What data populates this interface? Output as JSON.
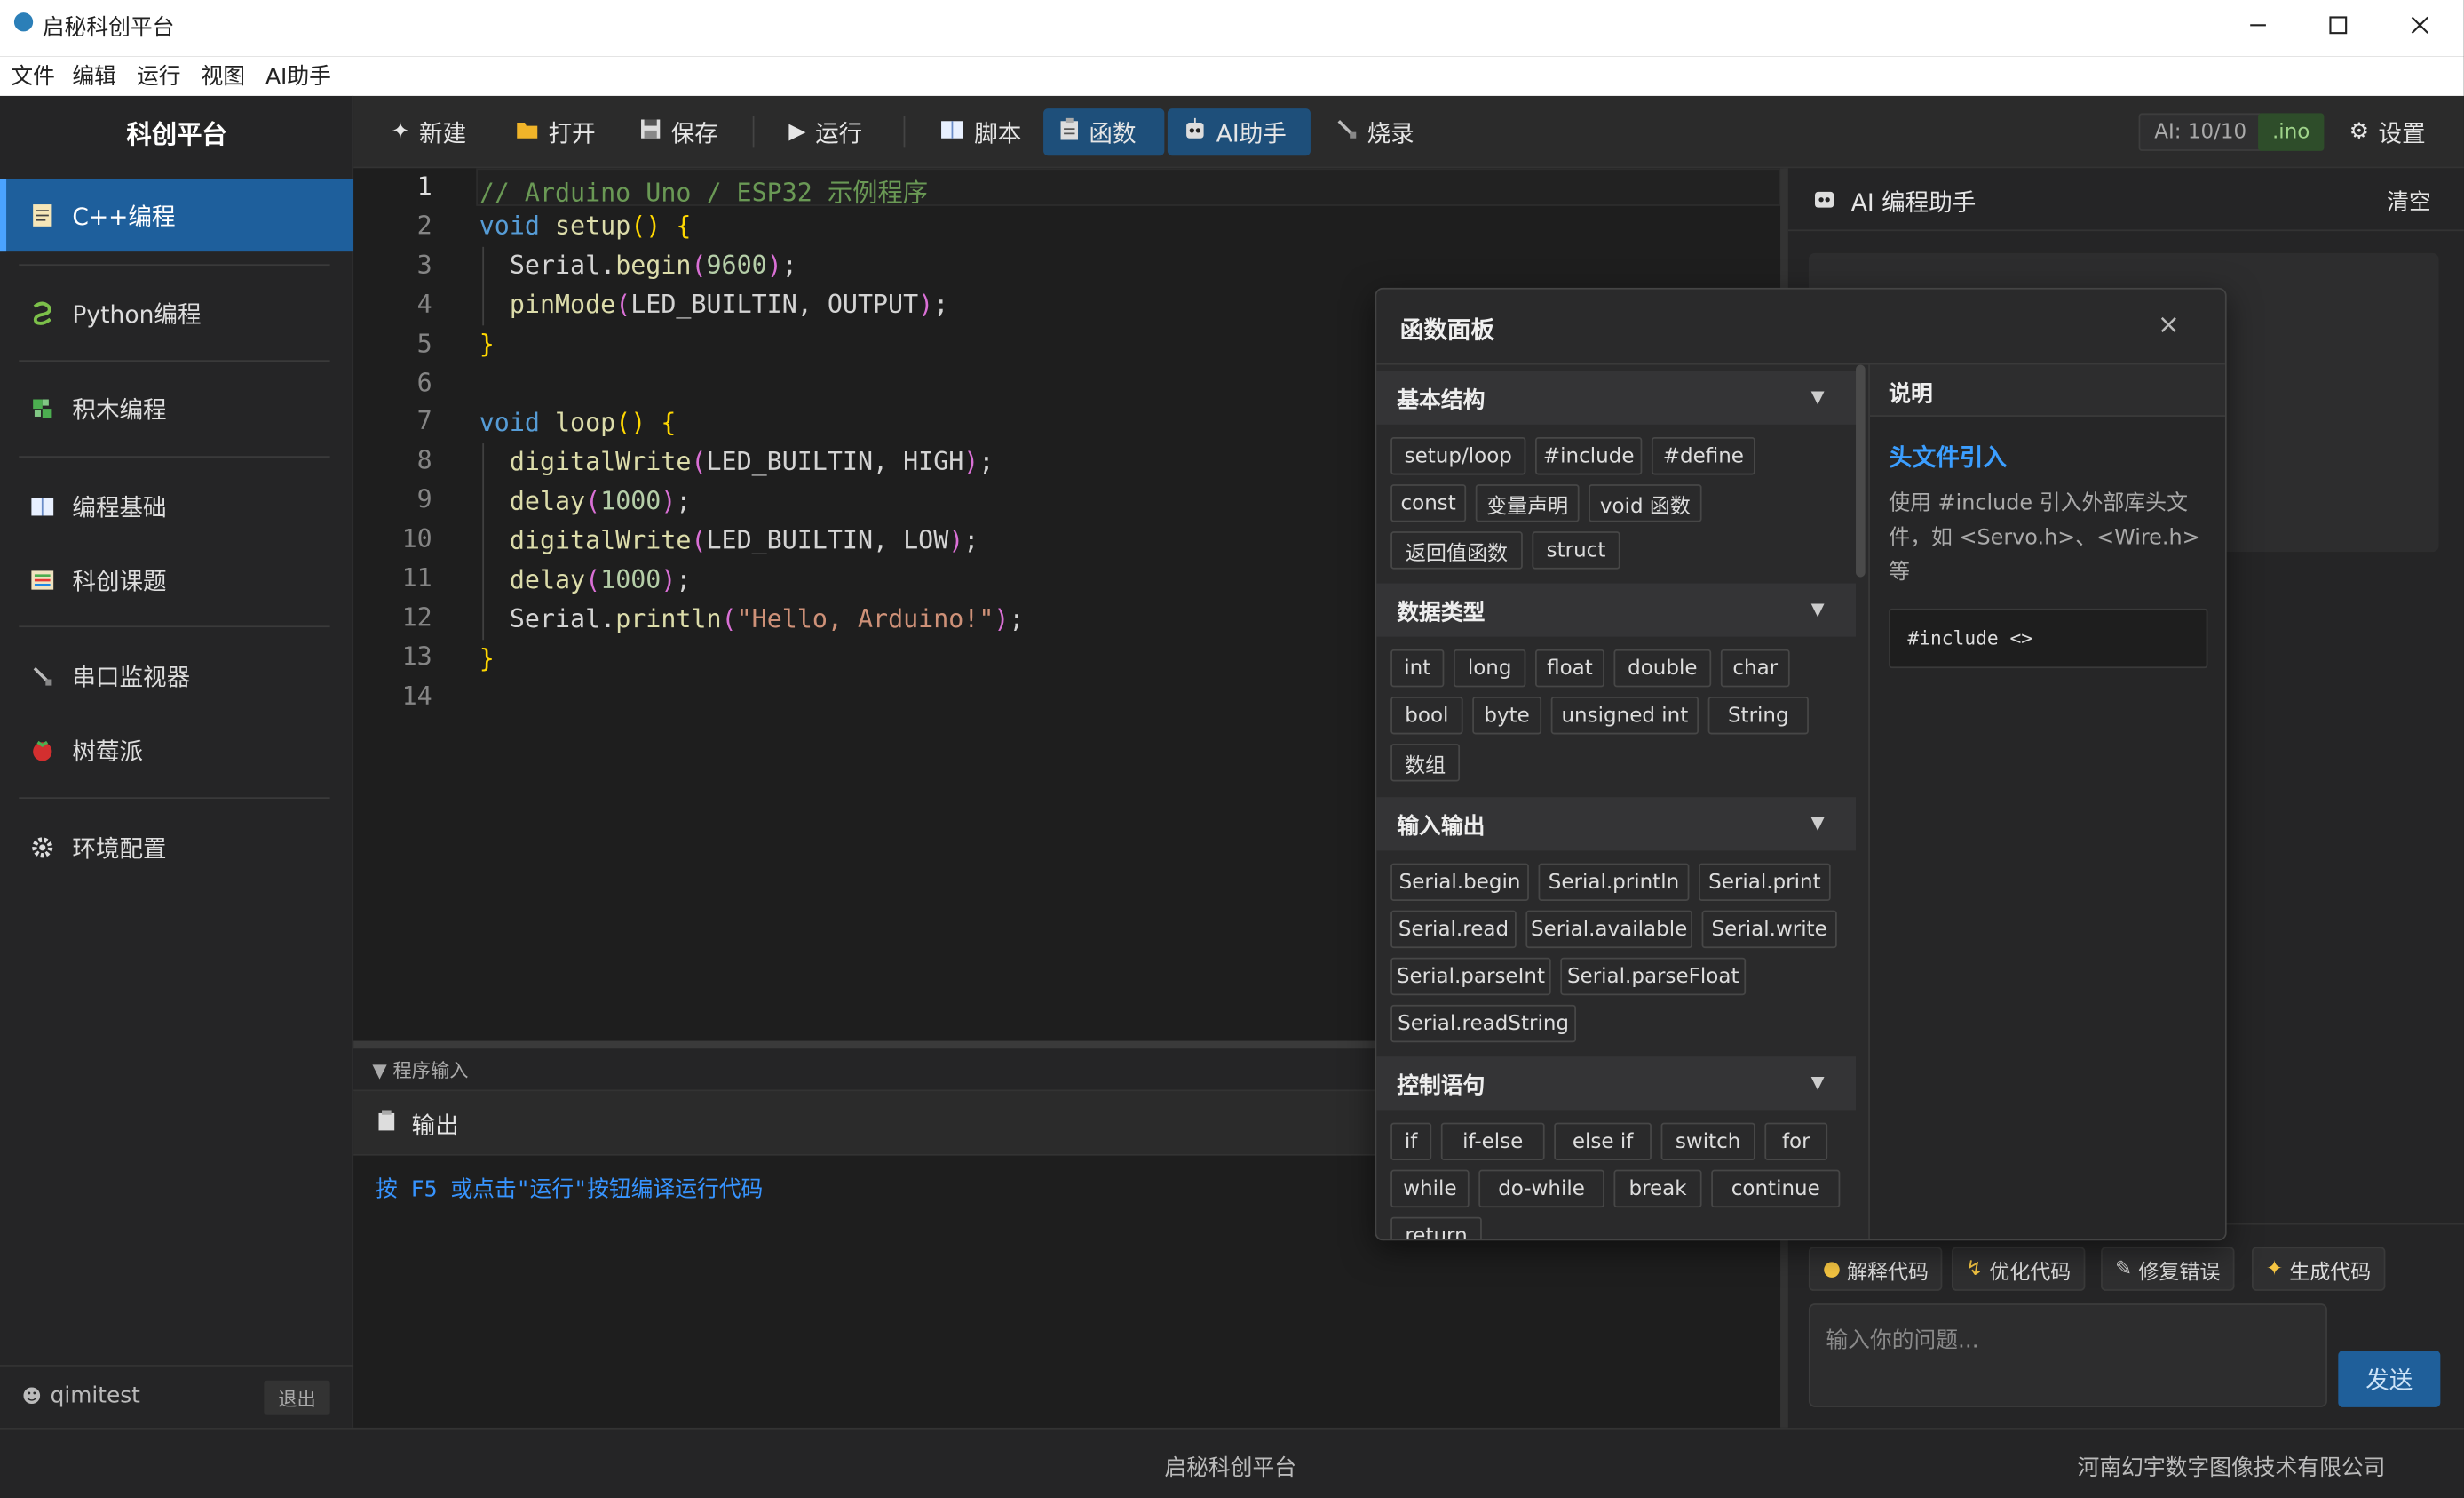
{
  "window": {
    "title": "启秘科创平台"
  },
  "menu": [
    "文件",
    "编辑",
    "运行",
    "视图",
    "AI助手"
  ],
  "sidebar": {
    "brand": "科创平台",
    "items": [
      {
        "label": "C++编程",
        "icon": "document-icon"
      },
      {
        "label": "Python编程",
        "icon": "python-icon"
      },
      {
        "label": "积木编程",
        "icon": "puzzle-icon"
      },
      {
        "label": "编程基础",
        "icon": "book-icon"
      },
      {
        "label": "科创课题",
        "icon": "list-icon"
      },
      {
        "label": "串口监视器",
        "icon": "plug-icon"
      },
      {
        "label": "树莓派",
        "icon": "raspberry-icon"
      },
      {
        "label": "环境配置",
        "icon": "gear-icon"
      }
    ],
    "user": "qimitest",
    "logout": "退出"
  },
  "toolbar": {
    "new": "新建",
    "open": "打开",
    "save": "保存",
    "run": "运行",
    "script": "脚本",
    "functions": "函数",
    "ai": "AI助手",
    "burn": "烧录",
    "ai_count": "AI: 10/10",
    "ext": ".ino",
    "settings": "设置"
  },
  "editor": {
    "lines": [
      "// Arduino Uno / ESP32 示例程序",
      "void setup() {",
      "  Serial.begin(9600);",
      "  pinMode(LED_BUILTIN, OUTPUT);",
      "}",
      "",
      "void loop() {",
      "  digitalWrite(LED_BUILTIN, HIGH);",
      "  delay(1000);",
      "  digitalWrite(LED_BUILTIN, LOW);",
      "  delay(1000);",
      "  Serial.println(\"Hello, Arduino!\");",
      "}",
      ""
    ],
    "current_line": 1
  },
  "input_panel": {
    "label": "▼ 程序输入"
  },
  "output": {
    "title": "输出",
    "hint": "按 F5 或点击\"运行\"按钮编译运行代码"
  },
  "ai_panel": {
    "title": "AI 编程助手",
    "clear": "清空",
    "quick": [
      {
        "label": "解释代码",
        "icon": "bulb-icon"
      },
      {
        "label": "优化代码",
        "icon": "bolt-icon"
      },
      {
        "label": "修复错误",
        "icon": "pencil-icon"
      },
      {
        "label": "生成代码",
        "icon": "sparkle-icon"
      }
    ],
    "placeholder": "输入你的问题...",
    "send": "发送"
  },
  "function_panel": {
    "title": "函数面板",
    "close": "×",
    "sections": [
      {
        "title": "基本结构",
        "items": [
          "setup/loop",
          "#include",
          "#define",
          "const",
          "变量声明",
          "void 函数",
          "返回值函数",
          "struct"
        ]
      },
      {
        "title": "数据类型",
        "items": [
          "int",
          "long",
          "float",
          "double",
          "char",
          "bool",
          "byte",
          "unsigned int",
          "String",
          "数组"
        ]
      },
      {
        "title": "输入输出",
        "items": [
          "Serial.begin",
          "Serial.println",
          "Serial.print",
          "Serial.read",
          "Serial.available",
          "Serial.write",
          "Serial.parseInt",
          "Serial.parseFloat",
          "Serial.readString"
        ]
      },
      {
        "title": "控制语句",
        "items": [
          "if",
          "if-else",
          "else if",
          "switch",
          "for",
          "while",
          "do-while",
          "break",
          "continue",
          "return"
        ]
      }
    ],
    "description": {
      "heading": "说明",
      "title": "头文件引入",
      "text": "使用 #include 引入外部库头文件，如 <Servo.h>、<Wire.h> 等",
      "example": "#include <>"
    }
  },
  "statusbar": {
    "center": "启秘科创平台",
    "right": "河南幻宇数字图像技术有限公司"
  }
}
